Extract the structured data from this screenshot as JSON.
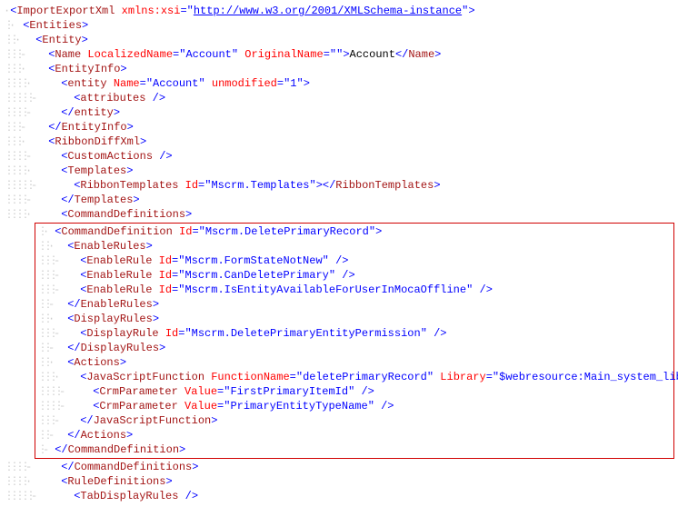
{
  "xml": {
    "xsiNs": "http://www.w3.org/2001/XMLSchema-instance",
    "entityLocalized": "Account",
    "entityOriginal": "",
    "entityText": "Account",
    "entityAttrName": "Account",
    "unmodified": "1",
    "ribbonTemplatesId": "Mscrm.Templates",
    "cmdDefId": "Mscrm.DeletePrimaryRecord",
    "enableRule1": "Mscrm.FormStateNotNew",
    "enableRule2": "Mscrm.CanDeletePrimary",
    "enableRule3": "Mscrm.IsEntityAvailableForUserInMocaOffline",
    "displayRuleId": "Mscrm.DeletePrimaryEntityPermission",
    "jsFuncName": "deletePrimaryRecord",
    "jsLibrary": "$webresource:Main_system_library.js",
    "crmParam1": "FirstPrimaryItemId",
    "crmParam2": "PrimaryEntityTypeName"
  },
  "t": {
    "ImportExportXml": "ImportExportXml",
    "xmlnsXsi": "xmlns:xsi",
    "Entities": "Entities",
    "Entity": "Entity",
    "Name": "Name",
    "LocalizedName": "LocalizedName",
    "OriginalName": "OriginalName",
    "EntityInfo": "EntityInfo",
    "entity": "entity",
    "NameAttr": "Name",
    "unmodified": "unmodified",
    "attributes": "attributes",
    "RibbonDiffXml": "RibbonDiffXml",
    "CustomActions": "CustomActions",
    "Templates": "Templates",
    "RibbonTemplates": "RibbonTemplates",
    "Id": "Id",
    "CommandDefinitions": "CommandDefinitions",
    "CommandDefinition": "CommandDefinition",
    "EnableRules": "EnableRules",
    "EnableRule": "EnableRule",
    "DisplayRules": "DisplayRules",
    "DisplayRule": "DisplayRule",
    "Actions": "Actions",
    "JavaScriptFunction": "JavaScriptFunction",
    "FunctionName": "FunctionName",
    "Library": "Library",
    "CrmParameter": "CrmParameter",
    "Value": "Value",
    "RuleDefinitions": "RuleDefinitions",
    "TabDisplayRules": "TabDisplayRules"
  }
}
